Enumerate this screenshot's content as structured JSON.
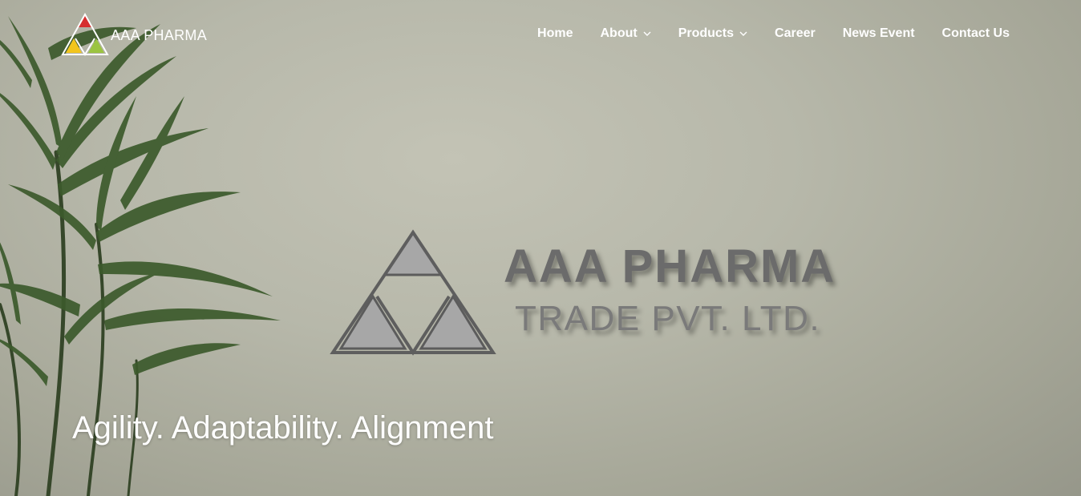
{
  "brand": {
    "name": "AAA PHARMA",
    "logo_icon": "aaa-pharma-triangle-logo-icon",
    "logo_colors": [
      "#d62f2f",
      "#f2c51d",
      "#9bc441"
    ]
  },
  "nav": {
    "items": [
      {
        "label": "Home",
        "has_dropdown": false
      },
      {
        "label": "About",
        "has_dropdown": true
      },
      {
        "label": "Products",
        "has_dropdown": true
      },
      {
        "label": "Career",
        "has_dropdown": false
      },
      {
        "label": "News Event",
        "has_dropdown": false
      },
      {
        "label": "Contact Us",
        "has_dropdown": false
      }
    ],
    "dropdown_icon": "chevron-down-icon"
  },
  "hero": {
    "sign_line1": "AAA PHARMA",
    "sign_line2": "TRADE PVT. LTD.",
    "tagline": "Agility. Adaptability. Alignment"
  },
  "colors": {
    "nav_text": "#ffffff",
    "wall": "#b9baac",
    "sign_text": "#6b6b6b"
  }
}
